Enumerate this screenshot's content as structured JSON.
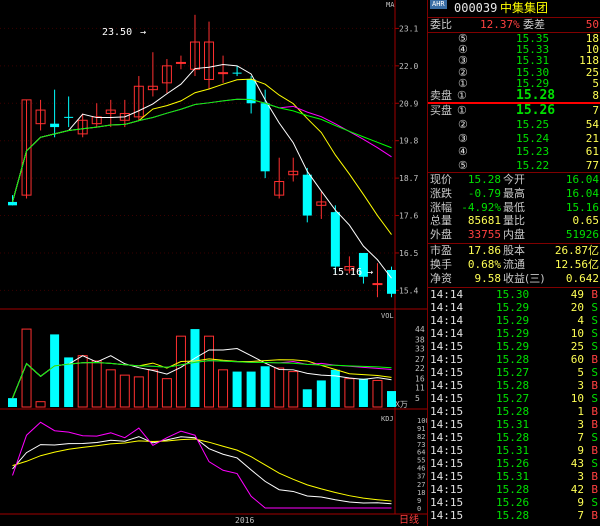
{
  "chart": {
    "price_ticks": [
      "23.1",
      "22.0",
      "20.9",
      "19.8",
      "18.7",
      "17.6",
      "16.5",
      "15.4"
    ],
    "vol_ticks": [
      "44",
      "38",
      "33",
      "27",
      "22",
      "16",
      "11",
      "5"
    ],
    "kdj_ticks": [
      "100",
      "91",
      "82",
      "73",
      "64",
      "55",
      "46",
      "37",
      "27",
      "18",
      "9",
      "0"
    ],
    "label_high": "23.50",
    "label_low": "15.16",
    "panel_vol": "VOL",
    "panel_kdj": "KDJ",
    "vol_unit": "X万",
    "year_label": "2016",
    "corner_top": "MA",
    "sheet_tab": "日线",
    "candles": [
      {
        "o": 17.9,
        "h": 18.2,
        "c": 18.0,
        "l": 17.9,
        "up": false
      },
      {
        "o": 18.2,
        "h": 21.0,
        "c": 21.0,
        "l": 18.1,
        "up": true
      },
      {
        "o": 20.3,
        "h": 21.0,
        "c": 20.7,
        "l": 20.1,
        "up": true
      },
      {
        "o": 20.2,
        "h": 21.3,
        "c": 20.3,
        "l": 19.9,
        "up": false
      },
      {
        "o": 20.5,
        "h": 21.1,
        "c": 20.5,
        "l": 20.2,
        "up": false
      },
      {
        "o": 20.0,
        "h": 20.6,
        "c": 20.4,
        "l": 19.9,
        "up": true
      },
      {
        "o": 20.3,
        "h": 20.9,
        "c": 20.5,
        "l": 20.2,
        "up": true
      },
      {
        "o": 20.6,
        "h": 21.0,
        "c": 20.7,
        "l": 20.2,
        "up": true
      },
      {
        "o": 20.6,
        "h": 21.0,
        "c": 20.4,
        "l": 20.2,
        "up": true
      },
      {
        "o": 20.5,
        "h": 21.7,
        "c": 21.4,
        "l": 20.4,
        "up": true
      },
      {
        "o": 21.3,
        "h": 22.4,
        "c": 21.4,
        "l": 21.1,
        "up": true
      },
      {
        "o": 21.5,
        "h": 22.2,
        "c": 22.0,
        "l": 21.2,
        "up": true
      },
      {
        "o": 22.1,
        "h": 22.3,
        "c": 22.1,
        "l": 21.9,
        "up": true
      },
      {
        "o": 21.9,
        "h": 23.5,
        "c": 22.7,
        "l": 21.7,
        "up": true
      },
      {
        "o": 22.7,
        "h": 23.3,
        "c": 21.6,
        "l": 21.3,
        "up": true
      },
      {
        "o": 21.8,
        "h": 22.3,
        "c": 21.8,
        "l": 21.5,
        "up": true
      },
      {
        "o": 21.8,
        "h": 22.0,
        "c": 21.8,
        "l": 21.7,
        "up": false
      },
      {
        "o": 21.6,
        "h": 21.7,
        "c": 20.9,
        "l": 20.6,
        "up": false
      },
      {
        "o": 20.9,
        "h": 21.3,
        "c": 18.9,
        "l": 18.7,
        "up": false
      },
      {
        "o": 18.6,
        "h": 19.3,
        "c": 18.2,
        "l": 18.1,
        "up": true
      },
      {
        "o": 18.8,
        "h": 19.3,
        "c": 18.9,
        "l": 18.6,
        "up": true
      },
      {
        "o": 18.8,
        "h": 19.0,
        "c": 17.6,
        "l": 17.4,
        "up": false
      },
      {
        "o": 17.9,
        "h": 18.3,
        "c": 18.0,
        "l": 17.5,
        "up": true
      },
      {
        "o": 17.7,
        "h": 17.9,
        "c": 16.1,
        "l": 15.9,
        "up": false
      },
      {
        "o": 16.1,
        "h": 16.4,
        "c": 16.0,
        "l": 15.9,
        "up": true
      },
      {
        "o": 16.5,
        "h": 16.5,
        "c": 15.8,
        "l": 15.6,
        "up": false
      },
      {
        "o": 15.6,
        "h": 16.2,
        "c": 15.6,
        "l": 15.2,
        "up": true
      },
      {
        "o": 16.0,
        "h": 16.1,
        "c": 15.3,
        "l": 15.2,
        "up": false
      }
    ],
    "volumes": [
      {
        "v": 5,
        "up": false
      },
      {
        "v": 44,
        "up": true
      },
      {
        "v": 3,
        "up": true
      },
      {
        "v": 41,
        "up": false
      },
      {
        "v": 28,
        "up": false
      },
      {
        "v": 29,
        "up": true
      },
      {
        "v": 26,
        "up": true
      },
      {
        "v": 21,
        "up": true
      },
      {
        "v": 18,
        "up": true
      },
      {
        "v": 17,
        "up": true
      },
      {
        "v": 21,
        "up": true
      },
      {
        "v": 16,
        "up": true
      },
      {
        "v": 40,
        "up": true
      },
      {
        "v": 44,
        "up": false
      },
      {
        "v": 40,
        "up": true
      },
      {
        "v": 21,
        "up": true
      },
      {
        "v": 20,
        "up": false
      },
      {
        "v": 20,
        "up": false
      },
      {
        "v": 23,
        "up": false
      },
      {
        "v": 22,
        "up": true
      },
      {
        "v": 20,
        "up": true
      },
      {
        "v": 10,
        "up": false
      },
      {
        "v": 15,
        "up": false
      },
      {
        "v": 21,
        "up": false
      },
      {
        "v": 16,
        "up": true
      },
      {
        "v": 16,
        "up": false
      },
      {
        "v": 15,
        "up": true
      },
      {
        "v": 9,
        "up": false
      }
    ]
  },
  "header": {
    "badge": "AHR",
    "code": "000039",
    "name": "中集集团"
  },
  "order_summary": {
    "weibi_label": "委比",
    "weibi_value": "12.37%",
    "weicha_label": "委差",
    "weicha_value": "50"
  },
  "sell_orders": [
    {
      "n": "⑤",
      "price": "15.35",
      "vol": "18"
    },
    {
      "n": "④",
      "price": "15.33",
      "vol": "10"
    },
    {
      "n": "③",
      "price": "15.31",
      "vol": "118"
    },
    {
      "n": "②",
      "price": "15.30",
      "vol": "25"
    },
    {
      "n": "①",
      "price": "15.29",
      "vol": "5"
    }
  ],
  "ask1": {
    "label": "卖盘",
    "n": "①",
    "price": "15.28",
    "vol": "8"
  },
  "bid1": {
    "label": "买盘",
    "n": "①",
    "price": "15.26",
    "vol": "7"
  },
  "buy_orders": [
    {
      "n": "②",
      "price": "15.25",
      "vol": "54"
    },
    {
      "n": "③",
      "price": "15.24",
      "vol": "21"
    },
    {
      "n": "④",
      "price": "15.23",
      "vol": "61"
    },
    {
      "n": "⑤",
      "price": "15.22",
      "vol": "77"
    }
  ],
  "quote": [
    {
      "l1": "现价",
      "v1": "15.28",
      "c1": "green",
      "l2": "今开",
      "v2": "16.04",
      "c2": "green"
    },
    {
      "l1": "涨跌",
      "v1": "-0.79",
      "c1": "green",
      "l2": "最高",
      "v2": "16.04",
      "c2": "green"
    },
    {
      "l1": "涨幅",
      "v1": "-4.92%",
      "c1": "green",
      "l2": "最低",
      "v2": "15.16",
      "c2": "green"
    },
    {
      "l1": "总量",
      "v1": "85681",
      "c1": "yellow",
      "l2": "量比",
      "v2": "0.65",
      "c2": "yellow"
    },
    {
      "l1": "外盘",
      "v1": "33755",
      "c1": "red",
      "l2": "内盘",
      "v2": "51926",
      "c2": "green"
    }
  ],
  "fundamentals": [
    {
      "l1": "市盈",
      "v1": "17.86",
      "l2": "股本",
      "v2": "26.87亿"
    },
    {
      "l1": "换手",
      "v1": "0.68%",
      "l2": "流通",
      "v2": "12.56亿"
    },
    {
      "l1": "净资",
      "v1": "9.58",
      "l2": "收益(三)",
      "v2": "0.642"
    }
  ],
  "ticks": [
    {
      "t": "14:14",
      "p": "15.30",
      "v": "49",
      "s": "B"
    },
    {
      "t": "14:14",
      "p": "15.29",
      "v": "20",
      "s": "S"
    },
    {
      "t": "14:14",
      "p": "15.29",
      "v": "4",
      "s": "S"
    },
    {
      "t": "14:14",
      "p": "15.29",
      "v": "10",
      "s": "S"
    },
    {
      "t": "14:15",
      "p": "15.29",
      "v": "25",
      "s": "S"
    },
    {
      "t": "14:15",
      "p": "15.28",
      "v": "60",
      "s": "B"
    },
    {
      "t": "14:15",
      "p": "15.27",
      "v": "5",
      "s": "S"
    },
    {
      "t": "14:15",
      "p": "15.28",
      "v": "3",
      "s": "B"
    },
    {
      "t": "14:15",
      "p": "15.27",
      "v": "10",
      "s": "S"
    },
    {
      "t": "14:15",
      "p": "15.28",
      "v": "1",
      "s": "B"
    },
    {
      "t": "14:15",
      "p": "15.31",
      "v": "3",
      "s": "B"
    },
    {
      "t": "14:15",
      "p": "15.28",
      "v": "7",
      "s": "S"
    },
    {
      "t": "14:15",
      "p": "15.31",
      "v": "9",
      "s": "B"
    },
    {
      "t": "14:15",
      "p": "15.26",
      "v": "43",
      "s": "S"
    },
    {
      "t": "14:15",
      "p": "15.31",
      "v": "3",
      "s": "B"
    },
    {
      "t": "14:15",
      "p": "15.28",
      "v": "42",
      "s": "B"
    },
    {
      "t": "14:15",
      "p": "15.26",
      "v": "9",
      "s": "S"
    },
    {
      "t": "14:15",
      "p": "15.28",
      "v": "7",
      "s": "B"
    }
  ]
}
